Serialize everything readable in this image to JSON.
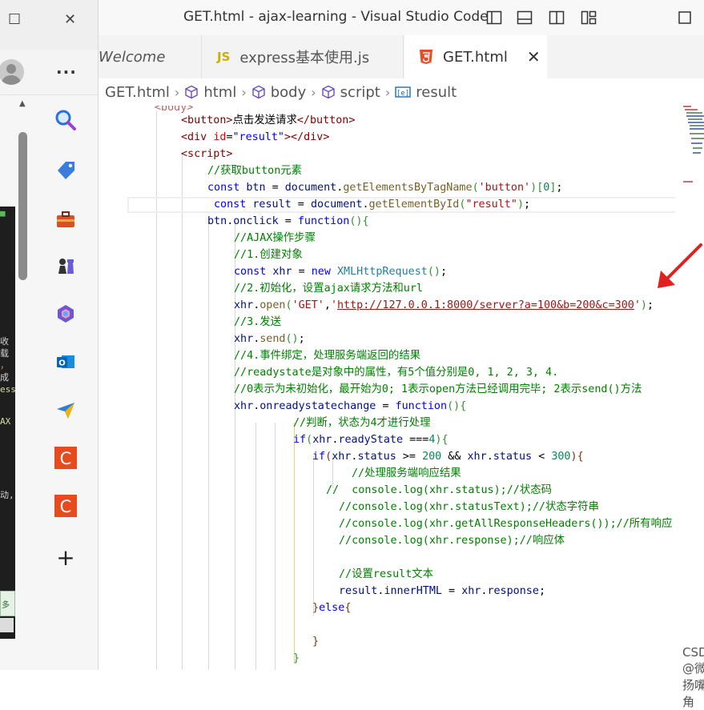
{
  "left_window": {
    "controls": {
      "restore": "☐",
      "close": "✕"
    },
    "more": "···",
    "sidebar_icons": [
      "search-icon",
      "tag-icon",
      "toolbox-icon",
      "chess-icon",
      "copilot-icon",
      "outlook-icon",
      "send-icon",
      "c-app-icon-1",
      "c-app-icon-2",
      "add-icon"
    ],
    "add_label": "+",
    "dark_fragments": [
      "收",
      "载",
      "，",
      "、",
      "成",
      "ess",
      "AX",
      "动,",
      "多"
    ]
  },
  "vscode": {
    "title": "GET.html - ajax-learning - Visual Studio Code",
    "tabs": [
      {
        "label": "Welcome"
      },
      {
        "label": "express基本使用.js",
        "badge": "JS"
      },
      {
        "label": "GET.html",
        "close": "✕"
      }
    ],
    "breadcrumb": [
      "GET.html",
      "html",
      "body",
      "script",
      "result"
    ],
    "accent_colors": {
      "html5": "#e44d26",
      "js": "#cbb000",
      "arrow": "#e32020"
    }
  },
  "code": {
    "line0": "<body>",
    "line1": {
      "open": "<button>",
      "text": "点击发送请求",
      "close": "</button>"
    },
    "line2": {
      "open": "<div ",
      "attr": "id",
      "eq": "=",
      "val": "\"result\"",
      "close": "></div>"
    },
    "line3": "<script>",
    "line4": "//获取button元素",
    "line5": {
      "kw": "const ",
      "var": "btn",
      "eq": " = ",
      "obj": "document",
      "dot": ".",
      "fn": "getElementsByTagName",
      "open": "(",
      "str": "'button'",
      "close": ")",
      "idx_open": "[",
      "num": "0",
      "idx_close": "]",
      "semi": ";"
    },
    "line6": {
      "kw": "const ",
      "var": "result",
      "eq": " = ",
      "obj": "document",
      "dot": ".",
      "fn": "getElementById",
      "open": "(",
      "str": "\"result\"",
      "close": ")",
      "semi": ";"
    },
    "line7": {
      "var": "btn",
      "dot": ".",
      "prop": "onclick",
      "eq": " = ",
      "kw": "function",
      "paren": "()",
      "brace": "{"
    },
    "line8": "//AJAX操作步骤",
    "line9": "//1.创建对象",
    "line10": {
      "kw": "const ",
      "var": "xhr",
      "eq": " = ",
      "new": "new ",
      "cls": "XMLHttpRequest",
      "paren": "()",
      "semi": ";"
    },
    "line11": "//2.初始化，设置ajax请求方法和url",
    "line12": {
      "var": "xhr",
      "dot": ".",
      "fn": "open",
      "open": "(",
      "str1": "'GET'",
      "comma": ",",
      "q1": "'",
      "url": "http://127.0.0.1:8000/server?a=100&b=200&c=300",
      "q2": "'",
      "close": ")",
      "semi": ";"
    },
    "line13": "//3.发送",
    "line14": {
      "var": "xhr",
      "dot": ".",
      "fn": "send",
      "paren": "()",
      "semi": ";"
    },
    "line15": "//4.事件绑定，处理服务端返回的结果",
    "line16": "//readystate是对象中的属性，有5个值分别是0, 1, 2, 3, 4.",
    "line17": {
      "a": "//0表示为未初始化，最开始为0; 1表示open方法已经调用完毕; 2表示",
      "b": "send()",
      "c": "方法"
    },
    "line18": {
      "var": "xhr",
      "dot": ".",
      "prop": "onreadystatechange",
      "eq": " = ",
      "kw": "function",
      "paren": "()",
      "brace": "{"
    },
    "line19": "//判断，状态为4才进行处理",
    "line20": {
      "kw": "if",
      "open": "(",
      "var": "xhr",
      "dot": ".",
      "prop": "readyState",
      "op": " ===",
      "num": "4",
      "close": ")",
      "brace": "{"
    },
    "line21": {
      "kw": "if",
      "open": "(",
      "var1": "xhr",
      "dot1": ".",
      "prop1": "status",
      "op1": " >= ",
      "num1": "200",
      "and": " && ",
      "var2": "xhr",
      "dot2": ".",
      "prop2": "status",
      "op2": " < ",
      "num2": "300",
      "close": ")",
      "brace": "{"
    },
    "line22": "//处理服务端响应结果",
    "line23": "//  console.log(xhr.status);//状态码",
    "line24": "//console.log(xhr.statusText);//状态字符串",
    "line25": "//console.log(xhr.getAllResponseHeaders());//所有响应",
    "line26": "//console.log(xhr.response);//响应体",
    "line27": "//设置result文本",
    "line28": {
      "var": "result",
      "dot": ".",
      "prop": "innerHTML",
      "eq": " = ",
      "var2": "xhr",
      "dot2": ".",
      "prop2": "response",
      "semi": ";"
    },
    "line29": {
      "close": "}",
      "kw": "else",
      "brace": "{"
    },
    "line30": "}",
    "line31": "}"
  },
  "watermark": "CSDN @微扬嘴角"
}
